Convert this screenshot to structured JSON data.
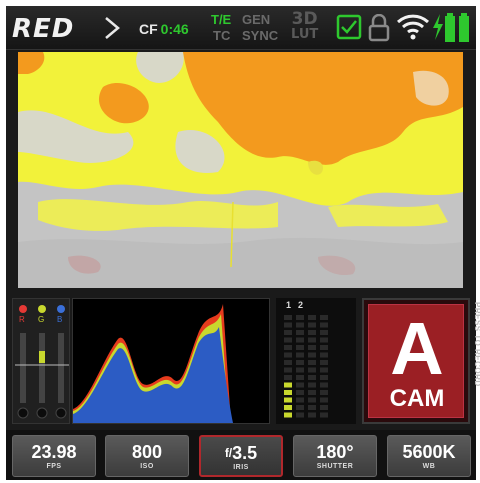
{
  "topbar": {
    "logo": "RED",
    "cf_label": "CF",
    "cf_time": "0:46",
    "tc_top": "T/E",
    "tc_bottom": "TC",
    "gen_top": "GEN",
    "gen_bottom": "SYNC",
    "lut_top": "3D",
    "lut_bottom": "LUT",
    "icons": [
      "checkbox-icon",
      "lock-icon",
      "wifi-icon",
      "power-bolt-icon",
      "battery-icon",
      "battery-icon"
    ],
    "accent": "#2ec82e"
  },
  "audio": {
    "channels": [
      "1",
      "2"
    ],
    "levels": [
      0.4,
      0.0
    ]
  },
  "meters": {
    "dots": [
      "#e53935",
      "#c8d82e",
      "#3a6fd8"
    ],
    "labels": [
      "R",
      "G",
      "B"
    ]
  },
  "camera": {
    "letter": "A",
    "label": "CAM",
    "side_label": "PRESS TO RECORD",
    "color": "#9b1f24"
  },
  "params": [
    {
      "value": "23.98",
      "label": "FPS"
    },
    {
      "value": "800",
      "label": "ISO"
    },
    {
      "prefix": "f/",
      "value": "3.5",
      "label": "IRIS",
      "selected": true
    },
    {
      "value": "180°",
      "label": "SHUTTER"
    },
    {
      "value": "5600K",
      "label": "WB"
    }
  ]
}
